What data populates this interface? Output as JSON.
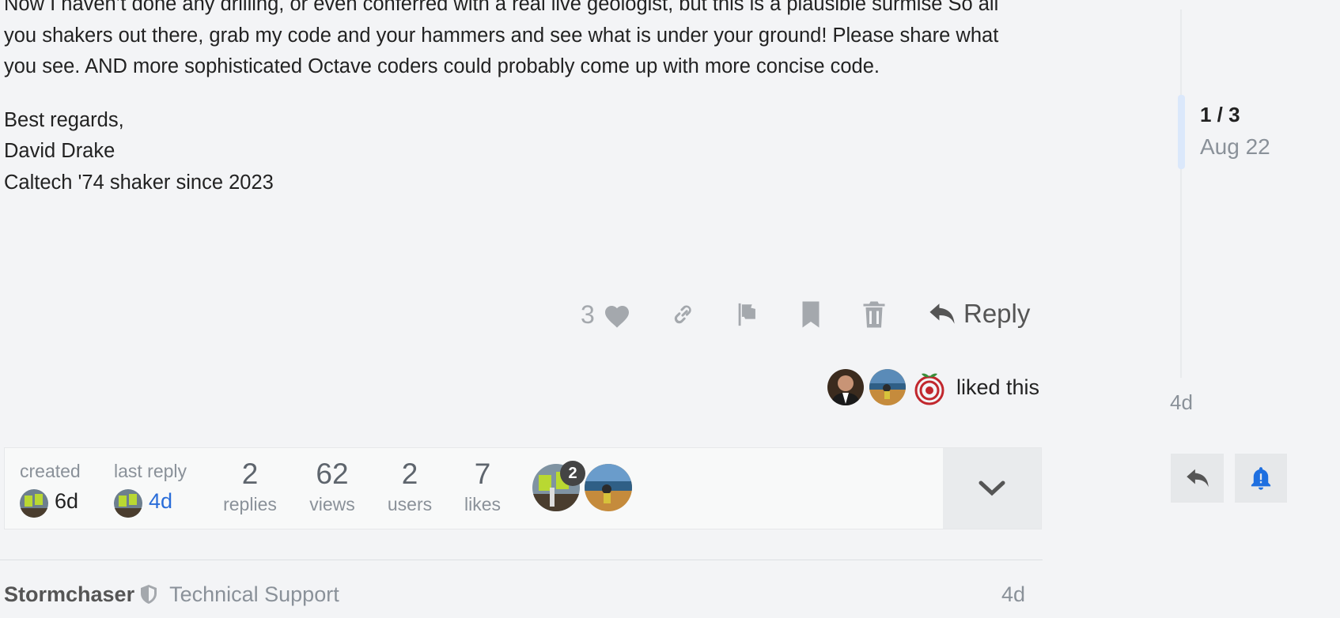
{
  "post": {
    "paragraph": "Now I haven’t done any drilling, or even conferred with a real live geologist, but this is a plausible surmise So all you shakers out there, grab my code and your hammers and see what is under your ground! Please share what you see. AND more sophisticated Octave coders could probably come up with more concise code.",
    "signature": [
      "Best regards,",
      "David Drake",
      "Caltech '74 shaker since 2023"
    ]
  },
  "actions": {
    "like_count": "3",
    "reply_label": "Reply",
    "icons": [
      "heart-icon",
      "link-icon",
      "flag-icon",
      "bookmark-icon",
      "trash-icon",
      "reply-arrow-icon"
    ]
  },
  "liked_by": {
    "text": "liked this",
    "count": 3
  },
  "topic_map": {
    "created_label": "created",
    "created_value": "6d",
    "last_reply_label": "last reply",
    "last_reply_value": "4d",
    "stats": [
      {
        "number": "2",
        "label": "replies"
      },
      {
        "number": "62",
        "label": "views"
      },
      {
        "number": "2",
        "label": "users"
      },
      {
        "number": "7",
        "label": "likes"
      }
    ],
    "participant_badge": "2"
  },
  "next_post": {
    "username": "Stormchaser",
    "user_title": "Technical Support",
    "time": "4d"
  },
  "timeline": {
    "position": "1 / 3",
    "date": "Aug 22",
    "end_label": "4d"
  },
  "colors": {
    "background": "#f3f4f6",
    "link_blue": "#2a6dd9",
    "notify_blue": "#1e6fe0",
    "muted_icon": "#a4a8ad",
    "timeline_handle": "#dbe8fb"
  }
}
